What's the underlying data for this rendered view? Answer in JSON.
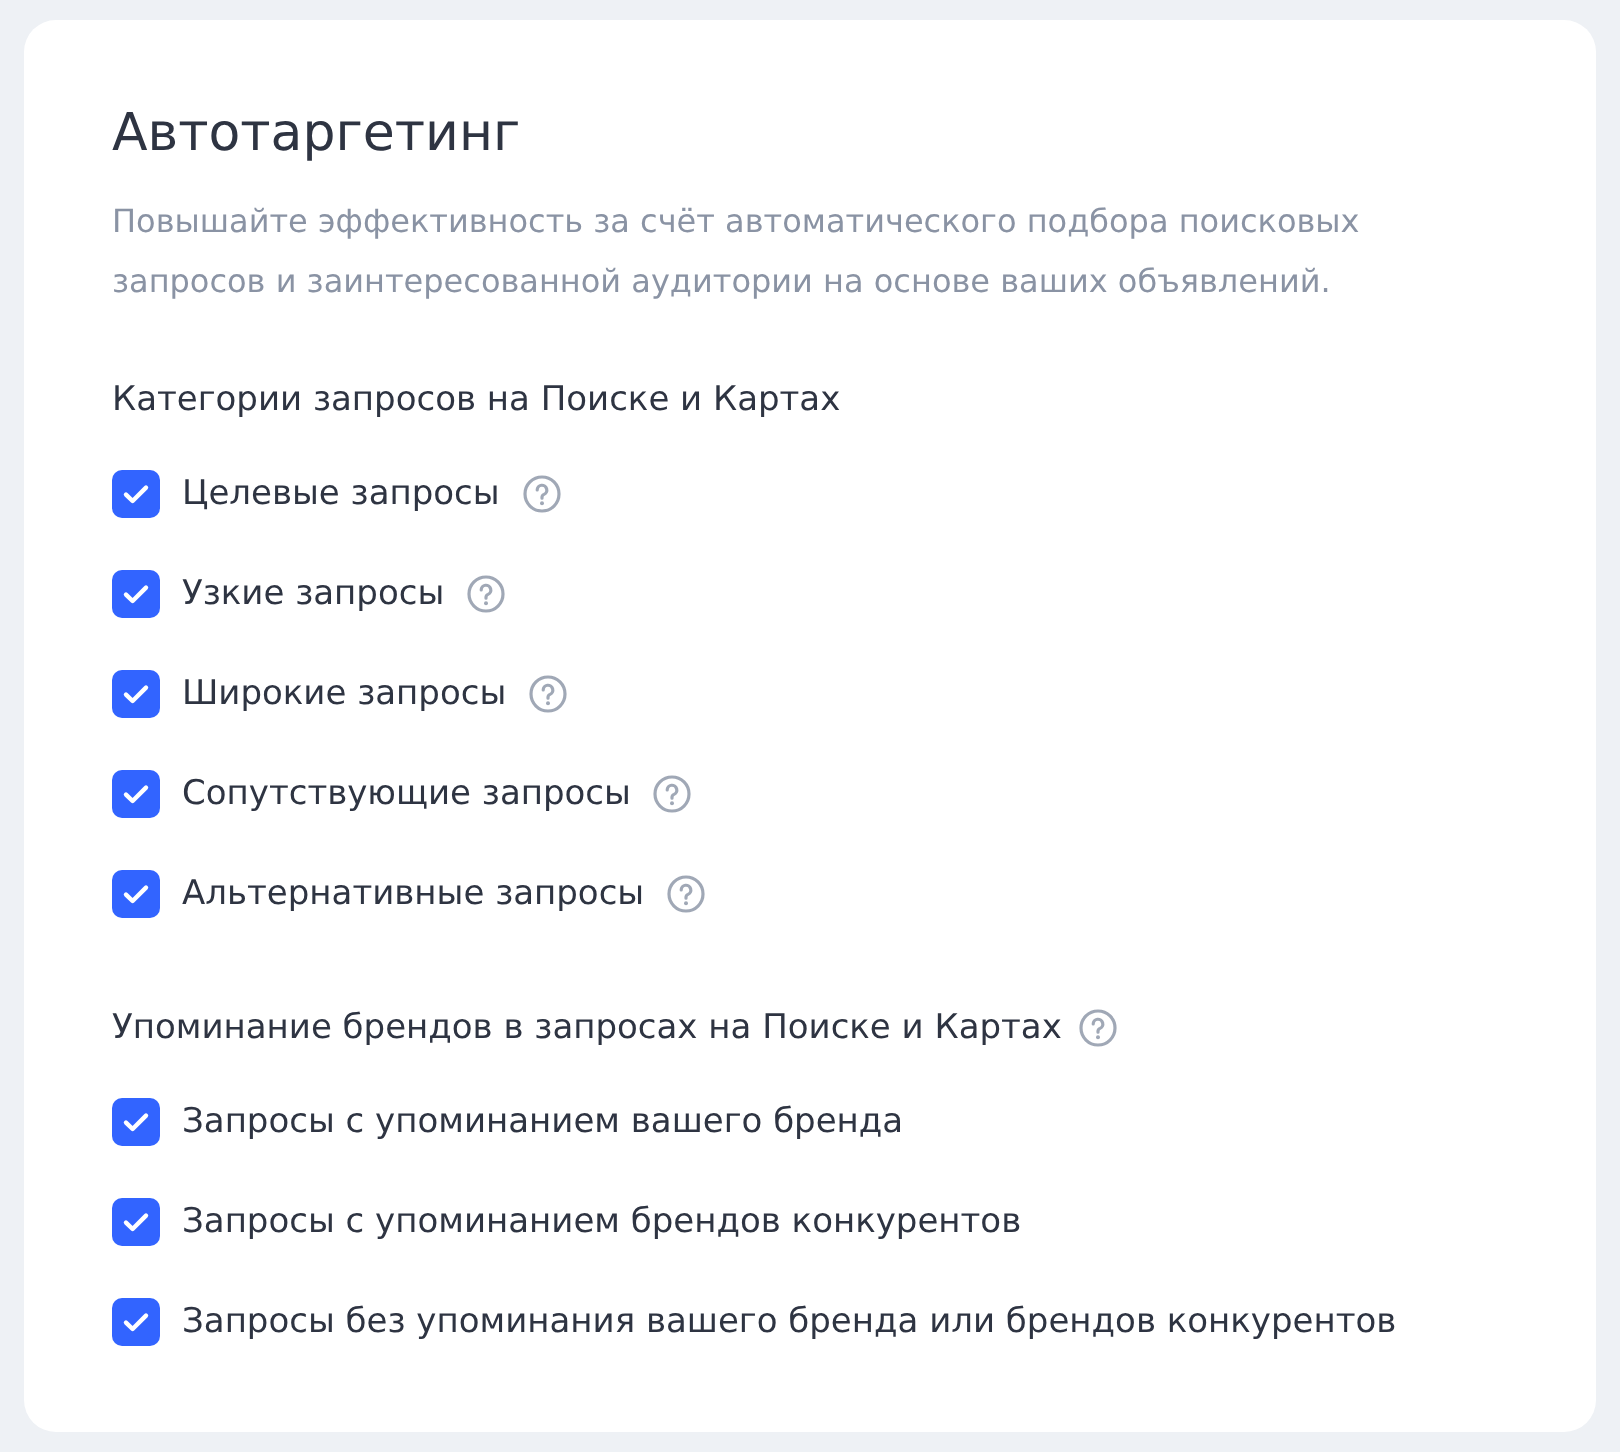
{
  "title": "Автотаргетинг",
  "description": "Повышайте эффективность за счёт автоматического подбора поисковых запросов и заинтересованной аудитории на основе ваших объявлений.",
  "sections": [
    {
      "heading": "Категории запросов на Поиске и Картах",
      "help": false,
      "options": [
        {
          "label": "Целевые запросы",
          "checked": true,
          "help": true
        },
        {
          "label": "Узкие запросы",
          "checked": true,
          "help": true
        },
        {
          "label": "Широкие запросы",
          "checked": true,
          "help": true
        },
        {
          "label": "Сопутствующие запросы",
          "checked": true,
          "help": true
        },
        {
          "label": "Альтернативные запросы",
          "checked": true,
          "help": true
        }
      ]
    },
    {
      "heading": "Упоминание брендов в запросах на Поиске и Картах",
      "help": true,
      "options": [
        {
          "label": "Запросы с упоминанием вашего бренда",
          "checked": true,
          "help": false
        },
        {
          "label": "Запросы с упоминанием брендов конкурентов",
          "checked": true,
          "help": false
        },
        {
          "label": "Запросы без упоминания вашего бренда или брендов конкурентов",
          "checked": true,
          "help": false
        }
      ]
    }
  ]
}
